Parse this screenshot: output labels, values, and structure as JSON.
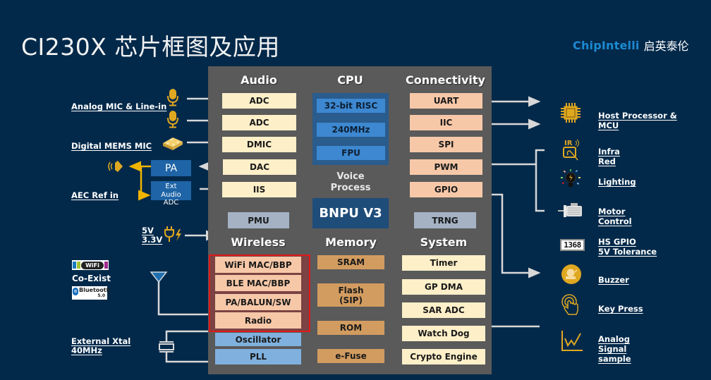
{
  "title": "CI230X 芯片框图及应用",
  "brand": {
    "name_en": "ChipIntelli",
    "name_cn": "启英泰伦",
    "color": "#1c8ad2"
  },
  "chip": {
    "audio": {
      "title": "Audio",
      "blocks": [
        "ADC",
        "ADC",
        "DMIC",
        "DAC",
        "IIS"
      ]
    },
    "cpu": {
      "title": "CPU",
      "blocks": [
        "32-bit RISC",
        "240MHz",
        "FPU"
      ]
    },
    "voice_process": "Voice\nProcess",
    "voice_process_lines": [
      "Voice",
      "Process"
    ],
    "bnpu": "BNPU V3",
    "connectivity": {
      "title": "Connectivity",
      "blocks": [
        "UART",
        "IIC",
        "SPI",
        "PWM",
        "GPIO"
      ]
    },
    "pmu": "PMU",
    "trng": "TRNG",
    "wireless": {
      "title": "Wireless",
      "blocks": [
        "WiFi MAC/BBP",
        "BLE MAC/BBP",
        "PA/BALUN/SW",
        "Radio"
      ],
      "clock_blocks": [
        "Oscillator",
        "PLL"
      ]
    },
    "memory": {
      "title": "Memory",
      "blocks": [
        "SRAM",
        "Flash\n(SIP)",
        "ROM",
        "e-Fuse"
      ],
      "flash_lines": [
        "Flash",
        "(SIP)"
      ]
    },
    "system": {
      "title": "System",
      "blocks": [
        "Timer",
        "GP DMA",
        "SAR ADC",
        "Watch Dog",
        "Crypto Engine"
      ]
    }
  },
  "left": {
    "analog_mic": "Analog MIC & Line-in",
    "digital_mems": "Digital MEMS MIC",
    "pa": "PA",
    "ext_audio_adc": [
      "Ext",
      "Audio",
      "ADC"
    ],
    "aec_ref": "AEC Ref in",
    "power": [
      "5V",
      "3.3V"
    ],
    "coexist": "Co-Exist",
    "wifi_logo": "WiFi",
    "bt_logo": "Bluetooth",
    "bt_version": "5.0",
    "xtal": [
      "External Xtal",
      "40MHz"
    ]
  },
  "right": {
    "host": [
      "Host Processor &",
      "MCU"
    ],
    "infrared": [
      "Infra",
      "Red"
    ],
    "lighting": "Lighting",
    "motor": [
      "Motor",
      "Control"
    ],
    "hs_gpio": [
      "HS GPIO",
      "5V Tolerance"
    ],
    "display_digits": "1368",
    "buzzer": "Buzzer",
    "key_press": "Key Press",
    "analog_signal": [
      "Analog",
      "Signal",
      "sample"
    ]
  },
  "colors": {
    "background": "#03294a",
    "chip": "#5a5a5a",
    "icon_gold": "#e0a820",
    "highlight_border": "#e01919"
  }
}
